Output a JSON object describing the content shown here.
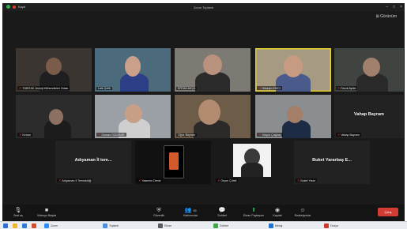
{
  "window": {
    "title": "Zoom Toplantı",
    "record_label": "Kayıt",
    "view_label": "Görünüm"
  },
  "colors": {
    "active_speaker": "#e6d22a",
    "end": "#d13d32",
    "share": "#2bb24c"
  },
  "participants": [
    {
      "name": "TÜBİTAK Jeoloji Mühendisleri Odası",
      "muted": true
    },
    {
      "name": "Lale Çelik",
      "muted": false
    },
    {
      "name": "ERTAN AKÇA",
      "muted": false
    },
    {
      "name": "Hüseyin EKİCİ",
      "muted": true
    },
    {
      "name": "Faruk Aydın",
      "muted": true
    },
    {
      "name": "Kenan",
      "muted": true
    },
    {
      "name": "Osman ÖZDEMİR",
      "muted": true
    },
    {
      "name": "Oğuz Bayram",
      "muted": false
    },
    {
      "name": "Selçuk Çağdaş",
      "muted": true
    },
    {
      "name": "Vahap Bayram",
      "muted": true,
      "big": "Vahap Bayram"
    },
    {
      "name": "Adıyaman Il Temsilciliği",
      "muted": true,
      "big": "Adıyaman İl tem..."
    },
    {
      "name": "Yasemin Demir",
      "muted": true
    },
    {
      "name": "Orçun Çöteli",
      "muted": true
    },
    {
      "name": "Buket Yarar",
      "muted": true,
      "big": "Buket Yararbaş E..."
    }
  ],
  "toolbar": {
    "unmute": "Sesi aç",
    "video": "Videoyu Başlat",
    "security": "Güvenlik",
    "participants": "Katılımcılar",
    "participants_count": "15",
    "chat": "Sohbet",
    "share": "Ekran Paylaşımı",
    "record": "Kaydet",
    "reactions": "Reaksiyonlar",
    "end": "Çıkış"
  },
  "taskbar": {
    "items": [
      "Zoom",
      "Toplantı",
      "Ekran",
      "Sohbet",
      "Mesaj",
      "Dosya"
    ]
  }
}
